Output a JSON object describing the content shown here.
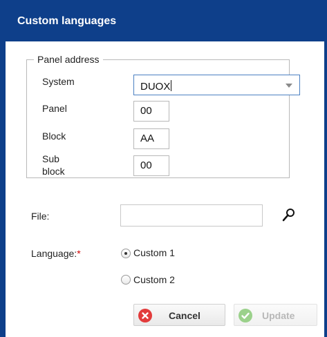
{
  "dialog": {
    "title": "Custom languages"
  },
  "panel_address": {
    "legend": "Panel address",
    "system_label": "System",
    "system_value": "DUOX",
    "panel_label": "Panel",
    "panel_value": "00",
    "block_label": "Block",
    "block_value": "AA",
    "sub_block_label_1": "Sub",
    "sub_block_label_2": "block",
    "sub_block_value": "00"
  },
  "file": {
    "label": "File:",
    "value": ""
  },
  "language": {
    "label": "Language:",
    "required_mark": "*",
    "options": [
      {
        "label": "Custom 1",
        "selected": true
      },
      {
        "label": "Custom 2",
        "selected": false
      }
    ]
  },
  "buttons": {
    "cancel_label": "Cancel",
    "update_label": "Update"
  },
  "colors": {
    "title_bar": "#0e3f8a",
    "cancel_icon": "#e23b3b",
    "update_icon": "#9bd18b",
    "required": "#d00000"
  }
}
